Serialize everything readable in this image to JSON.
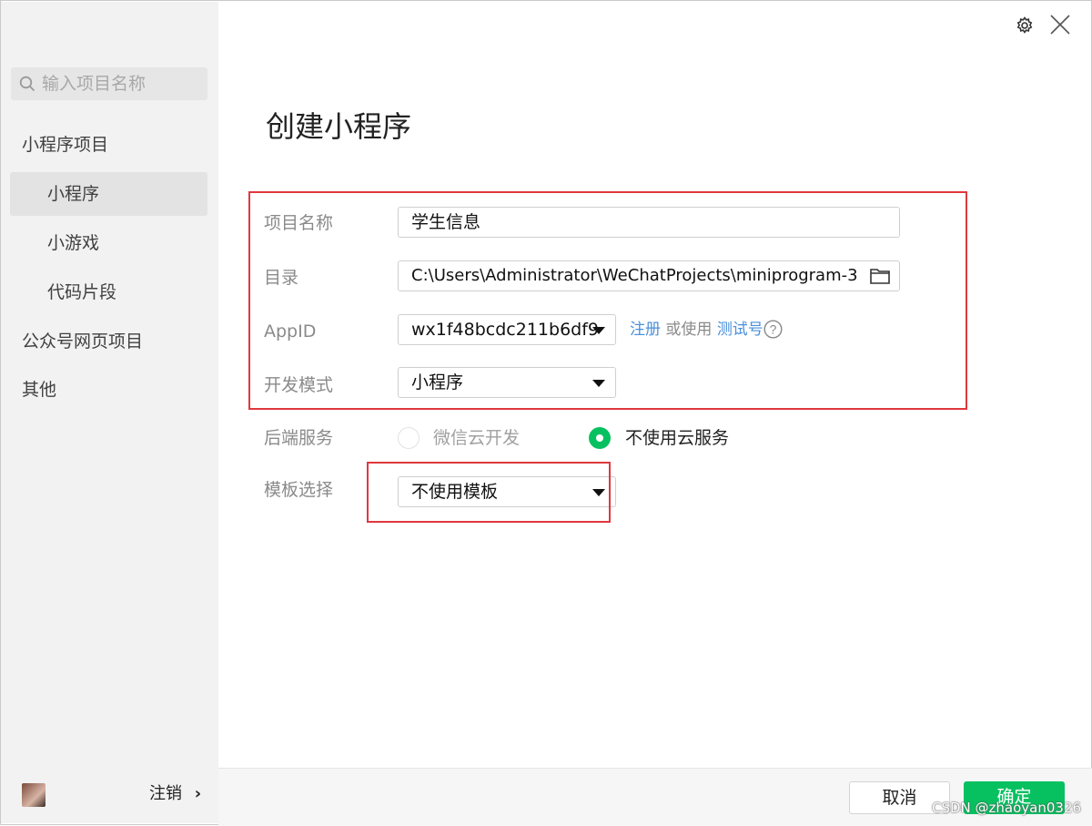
{
  "window": {
    "title": "创建小程序"
  },
  "toolbar": {
    "settings_icon": "gear-icon",
    "close_icon": "close-icon"
  },
  "sidebar": {
    "search_placeholder": "输入项目名称",
    "section_miniprogram": "小程序项目",
    "items": [
      {
        "label": "小程序",
        "selected": true
      },
      {
        "label": "小游戏",
        "selected": false
      },
      {
        "label": "代码片段",
        "selected": false
      }
    ],
    "section_official": "公众号网页项目",
    "section_other": "其他",
    "logout_label": "注销"
  },
  "form": {
    "project_name_label": "项目名称",
    "project_name_value": "学生信息",
    "directory_label": "目录",
    "directory_value": "C:\\Users\\Administrator\\WeChatProjects\\miniprogram-3",
    "appid_label": "AppID",
    "appid_value": "wx1f48bcdc211b6df9",
    "register_link": "注册",
    "or_use_text": "或使用",
    "test_account_link": "测试号",
    "dev_mode_label": "开发模式",
    "dev_mode_value": "小程序",
    "backend_label": "后端服务",
    "backend_option_cloud": "微信云开发",
    "backend_option_none": "不使用云服务",
    "backend_selected": "不使用云服务",
    "template_label": "模板选择",
    "template_value": "不使用模板"
  },
  "footer": {
    "cancel_label": "取消",
    "confirm_label": "确定"
  },
  "watermark": "CSDN @zhaoyan0326",
  "colors": {
    "accent": "#07c160",
    "annotation": "#e0383e",
    "link": "#4a90d9"
  }
}
